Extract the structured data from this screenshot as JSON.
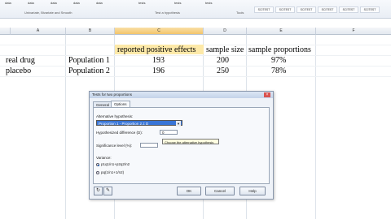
{
  "ribbon": {
    "items": [
      "data",
      "data",
      "data",
      "data",
      "data",
      "tests",
      "tests",
      "tests"
    ],
    "caption": "Univariate, Bivariate and Smooth",
    "caption2": "Test a hypothesis",
    "tools_label": "Tools",
    "right_buttons": [
      "SCITEST",
      "SCITEST",
      "SCITEST",
      "SCITEST",
      "SCITEST",
      "SCITEST"
    ]
  },
  "sheet": {
    "columns": [
      "A",
      "B",
      "C",
      "D",
      "E",
      "F"
    ],
    "headers": {
      "c": "reported positive effects",
      "d": "sample size",
      "e": "sample proportions"
    },
    "rows": [
      {
        "a": "real drug",
        "b": "Population 1",
        "c": "193",
        "d": "200",
        "e": "97%"
      },
      {
        "a": "placebo",
        "b": "Population 2",
        "c": "196",
        "d": "250",
        "e": "78%"
      }
    ]
  },
  "dialog": {
    "title": "Tests for two proportions",
    "close": "×",
    "tabs": [
      "General",
      "Options"
    ],
    "alt_label": "Alternative hypothesis:",
    "alt_value": "Proportion 1 - Proportion 2 ≠ D",
    "hyp_label": "Hypothesized difference (D):",
    "hyp_value": "0",
    "sig_label": "Significance level (%):",
    "tooltip": "Choose the alternative hypothesis",
    "variance_label": "Variance:",
    "variance_options": [
      "p1q1/n1+p2q2/n2",
      "pq(1/n1+1/n2)"
    ],
    "ok": "OK",
    "cancel": "Cancel",
    "help": "Help"
  }
}
